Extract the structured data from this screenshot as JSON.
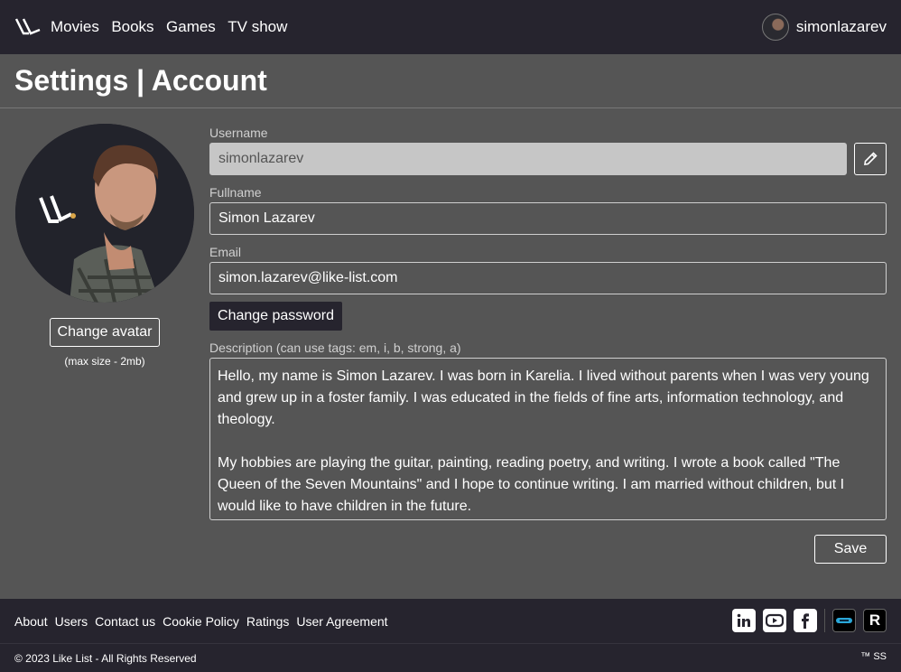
{
  "header": {
    "nav": [
      "Movies",
      "Books",
      "Games",
      "TV show"
    ],
    "username": "simonlazarev"
  },
  "page_title": "Settings | Account",
  "avatar": {
    "change_label": "Change avatar",
    "max_size": "(max size - 2mb)"
  },
  "form": {
    "username_label": "Username",
    "username_value": "simonlazarev",
    "fullname_label": "Fullname",
    "fullname_value": "Simon Lazarev",
    "email_label": "Email",
    "email_value": "simon.lazarev@like-list.com",
    "change_password_label": "Change password",
    "description_label": "Description (can use tags: em, i, b, strong, a)",
    "description_p1": "Hello, my name is Simon Lazarev. I was born in Karelia. I lived without parents when I was very young and grew up in a foster family. I was educated in the fields of fine arts, information technology, and theology.",
    "description_p2": "My hobbies are playing the guitar, painting, reading poetry, and writing. I wrote a book called \"The Queen of the Seven Mountains\" and I hope to continue writing. I am married without children, but I would like to have children in the future.",
    "save_label": "Save"
  },
  "footer": {
    "links": [
      "About",
      "Users",
      "Contact us",
      "Cookie Policy",
      "Ratings",
      "User Agreement"
    ],
    "socials": [
      "linkedin-icon",
      "youtube-icon",
      "facebook-icon",
      "app-icon",
      "r-icon"
    ],
    "r_text": "R",
    "copyright": "© 2023 Like List - All Rights Reserved",
    "tm": "™ SS"
  }
}
